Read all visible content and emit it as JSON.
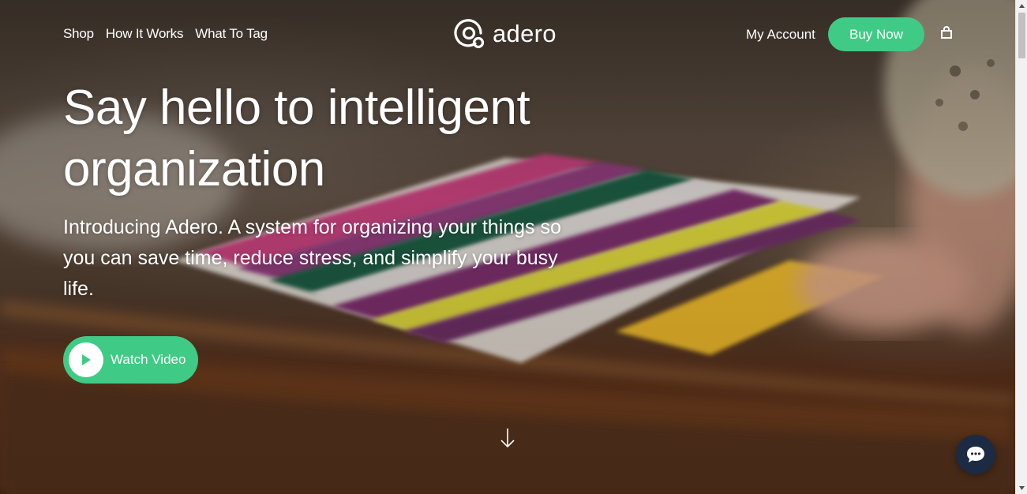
{
  "nav": {
    "links": [
      "Shop",
      "How It Works",
      "What To Tag"
    ],
    "logo_text": "adero",
    "account_label": "My Account",
    "buy_label": "Buy Now",
    "cart_icon": "shopping-bag-icon"
  },
  "hero": {
    "headline": "Say hello to intelligent organization",
    "subhead": "Introducing Adero. A system for organizing your things so you can save time, reduce stress, and simplify your busy life.",
    "watch_label": "Watch Video",
    "play_icon": "play-icon",
    "scroll_icon": "arrow-down-icon"
  },
  "chat": {
    "icon": "chat-bubble-icon"
  },
  "colors": {
    "accent": "#3fcb85",
    "chat": "#1c2a44",
    "text": "#ffffff"
  }
}
